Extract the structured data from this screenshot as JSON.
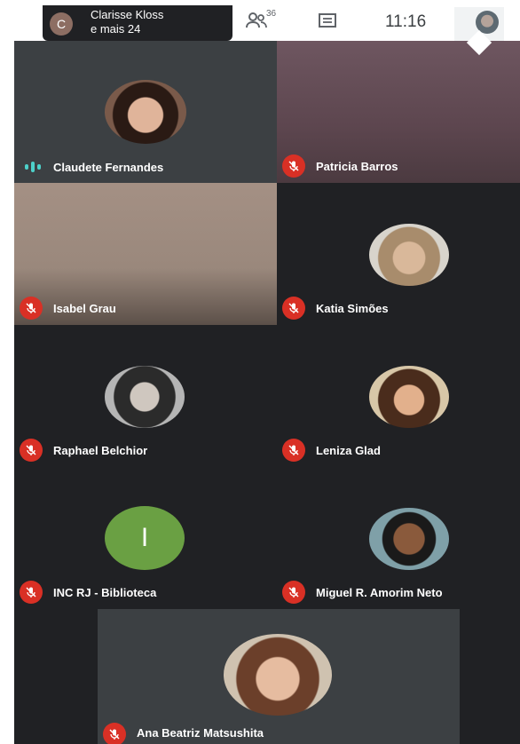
{
  "header": {
    "initial": "C",
    "host_name": "Clarisse Kloss",
    "others": "e mais 24",
    "participants_count": "36",
    "time": "11:16"
  },
  "tiles": [
    {
      "name": "Claudete Fernandes",
      "muted": false
    },
    {
      "name": "Patricia Barros",
      "muted": true
    },
    {
      "name": "Isabel Grau",
      "muted": true
    },
    {
      "name": "Katia Simões",
      "muted": true
    },
    {
      "name": "Raphael Belchior",
      "muted": true
    },
    {
      "name": "Leniza Glad",
      "muted": true
    },
    {
      "name": "INC RJ - Biblioteca",
      "muted": true,
      "initial": "I",
      "avatar_color": "#6aa043"
    },
    {
      "name": "Miguel R. Amorim Neto",
      "muted": true
    },
    {
      "name": "Ana Beatriz Matsushita",
      "muted": true
    }
  ],
  "icons": {
    "people": "people-icon",
    "chat": "chat-icon",
    "mic_off": "mic-off-icon"
  }
}
